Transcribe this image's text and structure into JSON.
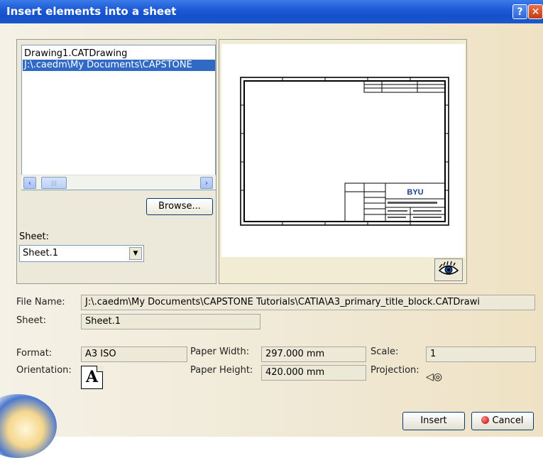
{
  "window": {
    "title": "Insert elements into a sheet",
    "help_label": "?",
    "close_label": "✕"
  },
  "file_list": {
    "items": [
      "Drawing1.CATDrawing",
      "J:\\.caedm\\My Documents\\CAPSTONE"
    ],
    "selected_index": 1,
    "scroll_left": "‹",
    "scroll_right": "›",
    "thumb_grip": "|||"
  },
  "browse_label": "Browse...",
  "sheet_select": {
    "label": "Sheet:",
    "value": "Sheet.1",
    "arrow": "▼"
  },
  "info": {
    "file_name_label": "File Name:",
    "file_name_value": "J:\\.caedm\\My Documents\\CAPSTONE Tutorials\\CATIA\\A3_primary_title_block.CATDrawi",
    "sheet_label": "Sheet:",
    "sheet_value": "Sheet.1",
    "format_label": "Format:",
    "format_value": "A3 ISO",
    "orientation_label": "Orientation:",
    "orientation_icon_letter": "A",
    "paper_width_label": "Paper Width:",
    "paper_width_value": "297.000 mm",
    "paper_height_label": "Paper Height:",
    "paper_height_value": "420.000 mm",
    "scale_label": "Scale:",
    "scale_value": "1",
    "projection_label": "Projection:",
    "projection_icon": "◁◎"
  },
  "preview": {
    "title_block_text": "BYU"
  },
  "buttons": {
    "insert": "Insert",
    "cancel": "Cancel"
  },
  "colors": {
    "titlebar": "#1e5ad6",
    "selection": "#316ac5",
    "close": "#c43c12"
  },
  "icons": {
    "eye": "eye-icon",
    "orientation": "portrait-orientation-icon",
    "projection": "first-angle-projection-icon"
  }
}
